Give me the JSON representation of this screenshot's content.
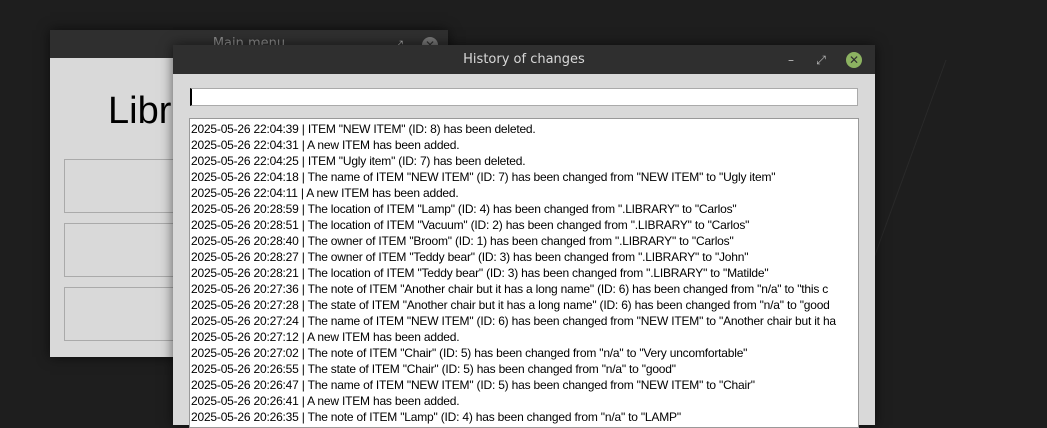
{
  "main_menu": {
    "title": "Main menu",
    "heading": "Libr",
    "controls": {
      "minimize": "–",
      "maximize": "⤢",
      "close": "✕"
    }
  },
  "history": {
    "title": "History of changes",
    "controls": {
      "minimize": "–",
      "maximize": "⤢",
      "close": "✕"
    },
    "search_value": "",
    "entries": [
      "2025-05-26 22:04:39 | ITEM \"NEW ITEM\" (ID: 8) has been deleted.",
      "2025-05-26 22:04:31 | A new ITEM has been added.",
      "2025-05-26 22:04:25 | ITEM \"Ugly item\" (ID: 7) has been deleted.",
      "2025-05-26 22:04:18 | The name of ITEM \"NEW ITEM\" (ID: 7) has been changed from \"NEW ITEM\" to \"Ugly item\"",
      "2025-05-26 22:04:11 | A new ITEM has been added.",
      "2025-05-26 20:28:59 | The location of ITEM \"Lamp\" (ID: 4) has been changed from \".LIBRARY\" to \"Carlos\"",
      "2025-05-26 20:28:51 | The location of ITEM \"Vacuum\" (ID: 2) has been changed from \".LIBRARY\" to \"Carlos\"",
      "2025-05-26 20:28:40 | The owner of ITEM \"Broom\" (ID: 1) has been changed from \".LIBRARY\" to \"Carlos\"",
      "2025-05-26 20:28:27 | The owner of ITEM \"Teddy bear\" (ID: 3) has been changed from \".LIBRARY\" to \"John\"",
      "2025-05-26 20:28:21 | The location of ITEM \"Teddy bear\" (ID: 3) has been changed from \".LIBRARY\" to \"Matilde\"",
      "2025-05-26 20:27:36 | The note of ITEM \"Another chair but it has a long name\" (ID: 6) has been changed from \"n/a\" to \"this c",
      "2025-05-26 20:27:28 | The state of ITEM \"Another chair but it has a long name\" (ID: 6) has been changed from \"n/a\" to \"good",
      "2025-05-26 20:27:24 | The name of ITEM \"NEW ITEM\" (ID: 6) has been changed from \"NEW ITEM\" to \"Another chair but it ha",
      "2025-05-26 20:27:12 | A new ITEM has been added.",
      "2025-05-26 20:27:02 | The note of ITEM \"Chair\" (ID: 5) has been changed from \"n/a\" to \"Very uncomfortable\"",
      "2025-05-26 20:26:55 | The state of ITEM \"Chair\" (ID: 5) has been changed from \"n/a\" to \"good\"",
      "2025-05-26 20:26:47 | The name of ITEM \"NEW ITEM\" (ID: 5) has been changed from \"NEW ITEM\" to \"Chair\"",
      "2025-05-26 20:26:41 | A new ITEM has been added.",
      "2025-05-26 20:26:35 | The note of ITEM \"Lamp\" (ID: 4) has been changed from \"n/a\" to \"LAMP\""
    ]
  }
}
